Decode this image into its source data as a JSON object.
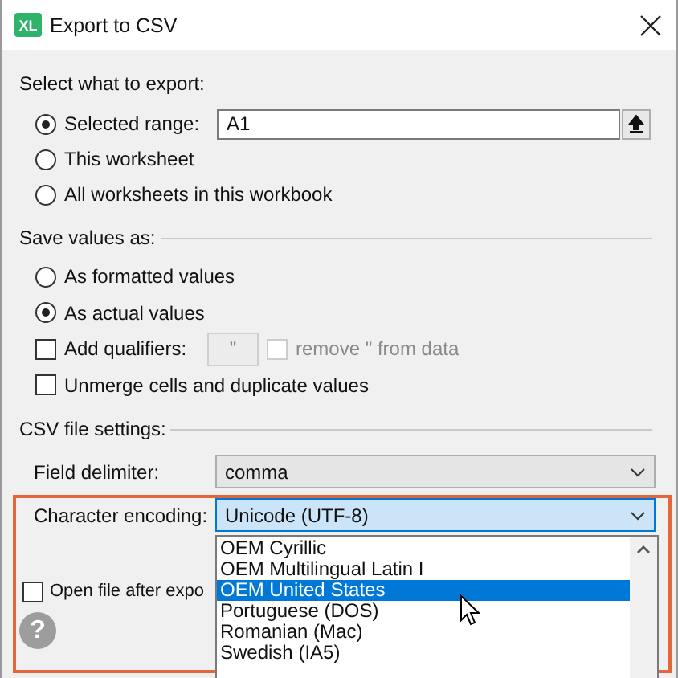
{
  "window": {
    "title": "Export to CSV",
    "logo": "XL"
  },
  "export_section": {
    "heading": "Select what to export:",
    "options": [
      {
        "label": "Selected range:",
        "selected": true,
        "kind": "range",
        "value": "A1"
      },
      {
        "label": "This worksheet",
        "selected": false,
        "kind": "plain"
      },
      {
        "label": "All worksheets in this workbook",
        "selected": false,
        "kind": "plain"
      }
    ]
  },
  "save_section": {
    "heading": "Save values as:",
    "options": [
      {
        "label": "As formatted values",
        "selected": false
      },
      {
        "label": "As actual values",
        "selected": true
      }
    ],
    "checks": [
      {
        "label": "Add qualifiers:",
        "checked": false,
        "kind": "qualifier",
        "qualifier": "\"",
        "sub_check": {
          "label": "remove \" from data",
          "checked": false,
          "disabled": true
        }
      },
      {
        "label": "Unmerge cells and duplicate values",
        "checked": false,
        "kind": "plain"
      }
    ]
  },
  "csv_section": {
    "heading": "CSV file settings:",
    "fields": [
      {
        "label": "Field delimiter:",
        "value": "comma",
        "focused": false
      },
      {
        "label": "Character encoding:",
        "value": "Unicode (UTF-8)",
        "focused": true
      }
    ]
  },
  "encoding_list": {
    "items": [
      {
        "label": "OEM Cyrillic",
        "selected": false
      },
      {
        "label": "OEM Multilingual Latin I",
        "selected": false
      },
      {
        "label": "OEM United States",
        "selected": true
      },
      {
        "label": "Portuguese (DOS)",
        "selected": false
      },
      {
        "label": "Romanian (Mac)",
        "selected": false
      },
      {
        "label": "Swedish (IA5)",
        "selected": false
      }
    ]
  },
  "open_after_export": {
    "label": "Open file after expo",
    "checked": false
  },
  "help": "?"
}
